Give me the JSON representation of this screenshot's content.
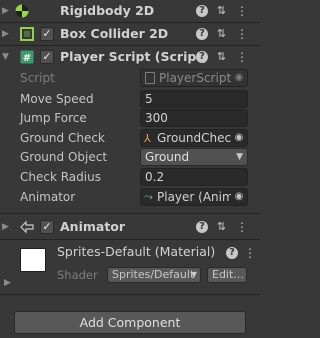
{
  "components": {
    "rigidbody": {
      "title": "Rigidbody 2D"
    },
    "box_collider": {
      "title": "Box Collider 2D"
    },
    "player_script": {
      "title": "Player Script (Script)"
    },
    "animator": {
      "title": "Animator"
    }
  },
  "properties": {
    "script": {
      "label": "Script",
      "value": "PlayerScript"
    },
    "move_speed": {
      "label": "Move Speed",
      "value": "5"
    },
    "jump_force": {
      "label": "Jump Force",
      "value": "300"
    },
    "ground_check": {
      "label": "Ground Check",
      "value": "GroundCheck"
    },
    "ground_object": {
      "label": "Ground Object",
      "value": "Ground"
    },
    "check_radius": {
      "label": "Check Radius",
      "value": "0.2"
    },
    "animator": {
      "label": "Animator",
      "value": "Player (Animator)"
    }
  },
  "material": {
    "title": "Sprites-Default (Material)",
    "shader_label": "Shader",
    "shader_value": "Sprites/Default",
    "edit_label": "Edit..."
  },
  "add_component_label": "Add Component",
  "colors": {
    "background": "#383838",
    "field_bg": "#2a2a2a",
    "rigidbody_icon": "#99d940",
    "collider_icon": "#8fd14f",
    "script_icon": "#3c9b6b"
  },
  "icons": {
    "rigidbody": "rigidbody-icon",
    "box_collider": "box-collider-icon",
    "script": "csharp-script-icon",
    "animator": "animator-icon",
    "help": "help-icon",
    "presets": "presets-icon",
    "kebab": "kebab-menu-icon",
    "object_picker": "object-picker-icon",
    "transform": "transform-icon"
  }
}
